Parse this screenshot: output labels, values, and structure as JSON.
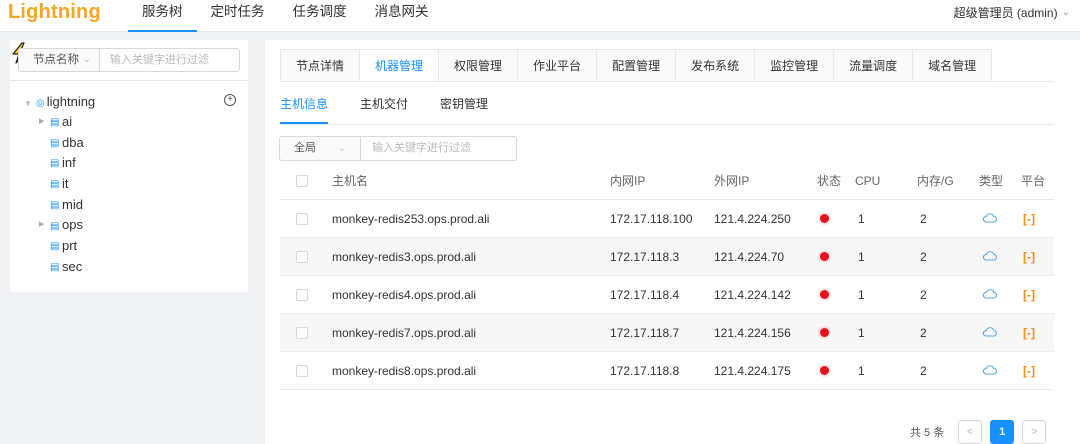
{
  "header": {
    "logo": "Lightning",
    "nav": [
      {
        "label": "服务树",
        "active": true
      },
      {
        "label": "定时任务",
        "active": false
      },
      {
        "label": "任务调度",
        "active": false
      },
      {
        "label": "消息网关",
        "active": false
      }
    ],
    "user": "超级管理员 (admin)"
  },
  "left": {
    "filter_select": "节点名称",
    "filter_placeholder": "输入关键字进行过滤",
    "tree_root": "lightning",
    "tree_nodes": [
      {
        "label": "ai",
        "expandable": true
      },
      {
        "label": "dba",
        "expandable": false
      },
      {
        "label": "inf",
        "expandable": false
      },
      {
        "label": "it",
        "expandable": false
      },
      {
        "label": "mid",
        "expandable": false
      },
      {
        "label": "ops",
        "expandable": true
      },
      {
        "label": "prt",
        "expandable": false
      },
      {
        "label": "sec",
        "expandable": false
      }
    ]
  },
  "right": {
    "tabs": [
      "节点详情",
      "机器管理",
      "权限管理",
      "作业平台",
      "配置管理",
      "发布系统",
      "监控管理",
      "流量调度",
      "域名管理"
    ],
    "active_tab": 1,
    "subtabs": [
      "主机信息",
      "主机交付",
      "密钥管理"
    ],
    "active_subtab": 0,
    "filter_select": "全局",
    "filter_placeholder": "输入关键字进行过滤",
    "columns": {
      "name": "主机名",
      "inner_ip": "内网IP",
      "outer_ip": "外网IP",
      "status": "状态",
      "cpu": "CPU",
      "mem": "内存/G",
      "type": "类型",
      "platform": "平台"
    },
    "rows": [
      {
        "name": "monkey-redis253.ops.prod.ali",
        "inner_ip": "172.17.118.100",
        "outer_ip": "121.4.224.250",
        "cpu": "1",
        "mem": "2"
      },
      {
        "name": "monkey-redis3.ops.prod.ali",
        "inner_ip": "172.17.118.3",
        "outer_ip": "121.4.224.70",
        "cpu": "1",
        "mem": "2"
      },
      {
        "name": "monkey-redis4.ops.prod.ali",
        "inner_ip": "172.17.118.4",
        "outer_ip": "121.4.224.142",
        "cpu": "1",
        "mem": "2"
      },
      {
        "name": "monkey-redis7.ops.prod.ali",
        "inner_ip": "172.17.118.7",
        "outer_ip": "121.4.224.156",
        "cpu": "1",
        "mem": "2"
      },
      {
        "name": "monkey-redis8.ops.prod.ali",
        "inner_ip": "172.17.118.8",
        "outer_ip": "121.4.224.175",
        "cpu": "1",
        "mem": "2"
      }
    ],
    "pagination": {
      "total": "共 5 条",
      "current": "1",
      "prev": "<",
      "next": ">"
    }
  },
  "colors": {
    "accent": "#1890ff",
    "logo": "#f5a623",
    "status_dot": "#e8101a",
    "platform_icon": "#fa8c16",
    "cloud_icon": "#5aa9e6"
  }
}
